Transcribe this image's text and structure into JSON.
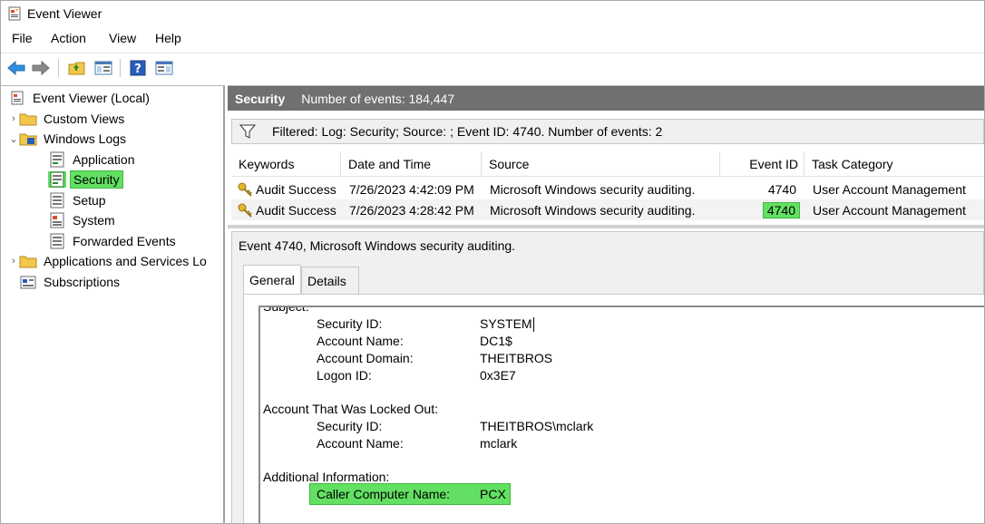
{
  "window": {
    "title": "Event Viewer"
  },
  "menu": [
    {
      "label": "File"
    },
    {
      "label": "Action"
    },
    {
      "label": "View"
    },
    {
      "label": "Help"
    }
  ],
  "toolbar": {
    "icons": [
      "back-arrow-icon",
      "forward-arrow-icon",
      "open-folder-icon",
      "console-tree-icon",
      "help-icon",
      "action-pane-icon"
    ]
  },
  "tree": {
    "root": "Event Viewer (Local)",
    "custom_views": "Custom Views",
    "windows_logs": "Windows Logs",
    "application": "Application",
    "security": "Security",
    "setup": "Setup",
    "system": "System",
    "forwarded_events": "Forwarded Events",
    "apps_services": "Applications and Services Lo",
    "subscriptions": "Subscriptions"
  },
  "header": {
    "title": "Security",
    "count": "Number of events: 184,447"
  },
  "filter": {
    "text": "Filtered: Log: Security; Source: ; Event ID: 4740. Number of events: 2"
  },
  "grid": {
    "columns": [
      "Keywords",
      "Date and Time",
      "Source",
      "Event ID",
      "Task Category"
    ],
    "rows": [
      {
        "keywords": "Audit Success",
        "date": "7/26/2023 4:42:09 PM",
        "source": "Microsoft Windows security auditing.",
        "event_id": "4740",
        "task": "User Account Management"
      },
      {
        "keywords": "Audit Success",
        "date": "7/26/2023 4:28:42 PM",
        "source": "Microsoft Windows security auditing.",
        "event_id": "4740",
        "task": "User Account Management"
      }
    ]
  },
  "detail": {
    "heading": "Event 4740, Microsoft Windows security auditing.",
    "tabs": [
      "General",
      "Details"
    ],
    "subject_label": "Subject:",
    "subject": [
      {
        "key": "Security ID:",
        "value": "SYSTEM"
      },
      {
        "key": "Account Name:",
        "value": "DC1$"
      },
      {
        "key": "Account Domain:",
        "value": "THEITBROS"
      },
      {
        "key": "Logon ID:",
        "value": "0x3E7"
      }
    ],
    "locked_label": "Account That Was Locked Out:",
    "locked": [
      {
        "key": "Security ID:",
        "value": "THEITBROS\\mclark"
      },
      {
        "key": "Account Name:",
        "value": "mclark"
      }
    ],
    "additional_label": "Additional Information:",
    "additional": [
      {
        "key": "Caller Computer Name:",
        "value": "PCX"
      }
    ]
  },
  "colors": {
    "highlight": "#63e063",
    "header_bg": "#707070"
  }
}
